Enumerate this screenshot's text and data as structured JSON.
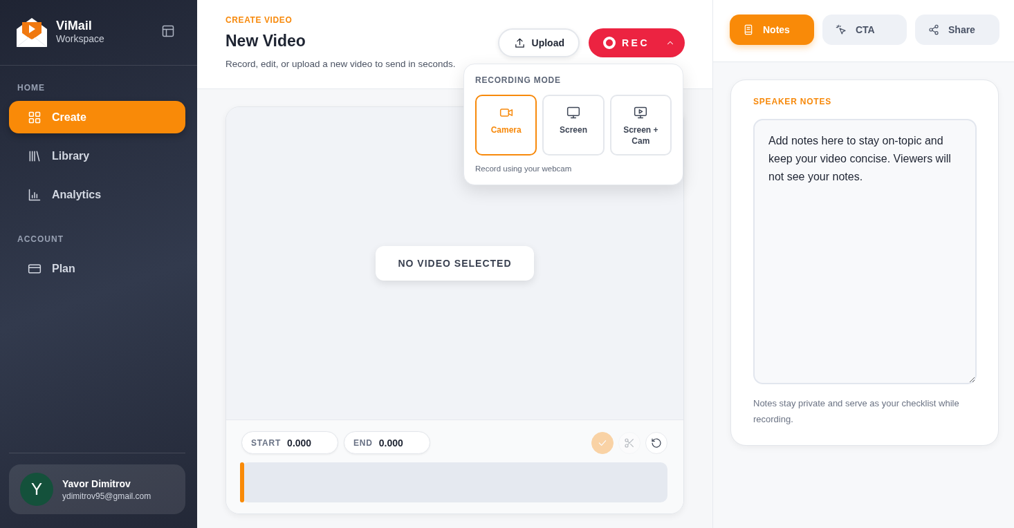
{
  "sidebar": {
    "brand": {
      "name": "ViMail",
      "subtitle": "Workspace"
    },
    "sections": [
      {
        "heading": "HOME",
        "items": [
          {
            "label": "Create",
            "selected": true
          },
          {
            "label": "Library",
            "selected": false
          },
          {
            "label": "Analytics",
            "selected": false
          }
        ]
      },
      {
        "heading": "ACCOUNT",
        "items": [
          {
            "label": "Plan",
            "selected": false
          }
        ]
      }
    ],
    "user": {
      "initial": "Y",
      "name": "Yavor Dimitrov",
      "email": "ydimitrov95@gmail.com"
    }
  },
  "header": {
    "eyebrow": "CREATE VIDEO",
    "title": "New Video",
    "subtitle": "Record, edit, or upload a new video to send in seconds.",
    "upload_button": "Upload",
    "rec_button": {
      "label": "REC",
      "expanded": true
    }
  },
  "recording_menu": {
    "heading": "RECORDING MODE",
    "modes": [
      {
        "label": "Camera",
        "selected": true
      },
      {
        "label": "Screen",
        "selected": false
      },
      {
        "label": "Screen + Cam",
        "selected": false
      }
    ],
    "hint": "Record using your webcam"
  },
  "editor": {
    "empty_message": "NO VIDEO SELECTED",
    "start": {
      "label": "START",
      "value": "0.000"
    },
    "end": {
      "label": "END",
      "value": "0.000"
    },
    "actions": [
      {
        "kind": "confirm",
        "disabled": true
      },
      {
        "kind": "cut",
        "disabled": true
      },
      {
        "kind": "reset",
        "disabled": false
      }
    ]
  },
  "right_panel": {
    "tabs": [
      {
        "label": "Notes",
        "selected": true
      },
      {
        "label": "CTA",
        "selected": false
      },
      {
        "label": "Share",
        "selected": false
      }
    ],
    "notes": {
      "heading": "SPEAKER NOTES",
      "value": "Add notes here to stay on-topic and keep your video concise. Viewers will not see your notes.",
      "footnote": "Notes stay private and serve as your checklist while recording."
    }
  }
}
